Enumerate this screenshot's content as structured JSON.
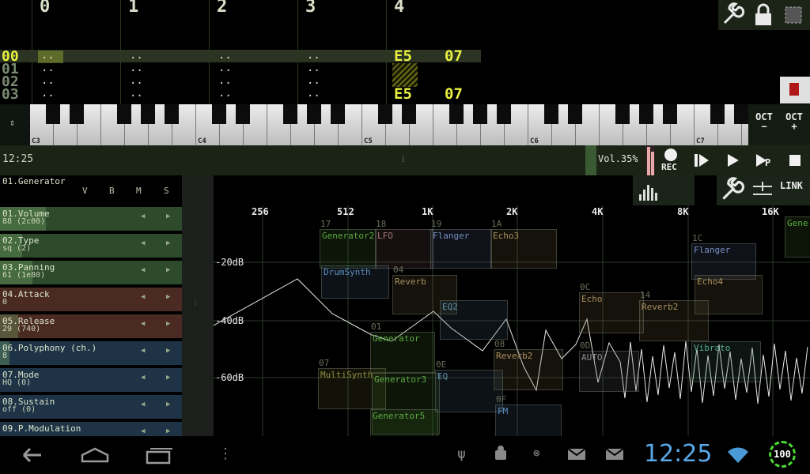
{
  "tracker": {
    "columns": [
      "0",
      "1",
      "2",
      "3",
      "4"
    ],
    "rows": [
      "00",
      "01",
      "02",
      "03"
    ],
    "empty_cell": "..",
    "notes": [
      {
        "row": "00",
        "note": "E5",
        "vol": "07"
      },
      {
        "row": "03",
        "note": "E5",
        "vol": "07"
      }
    ]
  },
  "top_icons": [
    "wrench-icon",
    "lock-icon",
    "select-icon"
  ],
  "side_button_icon": "record-pattern-icon",
  "keyboard": {
    "octave_labels": [
      "C3",
      "C4",
      "C5",
      "C6",
      "C7"
    ],
    "oct_down": "OCT-",
    "oct_down_a": "OCT",
    "oct_down_b": "−",
    "oct_up_a": "OCT",
    "oct_up_b": "+"
  },
  "transport": {
    "time": "12:25",
    "divider": "⁞",
    "volume": "Vol.35%",
    "rec": "REC",
    "p": "P"
  },
  "generator": {
    "title": "01.Generator",
    "cols": [
      "V",
      "B",
      "M",
      "S"
    ],
    "params": [
      {
        "name": "01.Volume",
        "value": "88 (2c00)",
        "color": "#2d4a2a",
        "fill": 0.25
      },
      {
        "name": "02.Type",
        "value": "sq (2)",
        "color": "#2d4a2a",
        "fill": 0.12
      },
      {
        "name": "03.Panning",
        "value": "61 (1e80)",
        "color": "#2d4a2a",
        "fill": 0.18
      },
      {
        "name": "04.Attack",
        "value": "0",
        "color": "#4a2a22",
        "fill": 0
      },
      {
        "name": "05.Release",
        "value": "29 (740)",
        "color": "#4a2a22",
        "fill": 0.1
      },
      {
        "name": "06.Polyphony (ch.)",
        "value": "8",
        "color": "#1e3446",
        "fill": 0.05
      },
      {
        "name": "07.Mode",
        "value": "HQ (0)",
        "color": "#1e3446",
        "fill": 0
      },
      {
        "name": "08.Sustain",
        "value": "off (0)",
        "color": "#1e3446",
        "fill": 0
      },
      {
        "name": "09.P.Modulation",
        "value": "",
        "color": "#1e3446",
        "fill": 0
      }
    ]
  },
  "spectrum": {
    "freq_labels": [
      "256",
      "512",
      "1K",
      "2K",
      "4K",
      "8K",
      "16K"
    ],
    "db_labels": [
      "-20dB",
      "-40dB",
      "-60dB"
    ],
    "link": "LINK",
    "modules": [
      {
        "num": "17",
        "label": "Generator2",
        "color": "#3a6a2a"
      },
      {
        "num": "18",
        "label": "LFO",
        "color": "#6a4a4a"
      },
      {
        "num": "19",
        "label": "Flanger",
        "color": "#4a5a7a"
      },
      {
        "num": "1A",
        "label": "Echo3",
        "color": "#6a5a3a"
      },
      {
        "num": "1C",
        "label": "Flanger",
        "color": "#4a5a7a"
      },
      {
        "num": "04",
        "label": "Reverb",
        "color": "#6a5a3a"
      },
      {
        "num": "",
        "label": "DrumSynth",
        "color": "#3a5a7a"
      },
      {
        "num": "",
        "label": "EQ2",
        "color": "#3a5a6a"
      },
      {
        "num": "",
        "label": "Echo4",
        "color": "#6a5a3a"
      },
      {
        "num": "0C",
        "label": "Echo",
        "color": "#6a5a3a"
      },
      {
        "num": "14",
        "label": "Reverb2",
        "color": "#6a5a3a"
      },
      {
        "num": "01",
        "label": "Generator",
        "color": "#3a6a2a"
      },
      {
        "num": "",
        "label": "Vibrato",
        "color": "#3a6a5a"
      },
      {
        "num": "08",
        "label": "Reverb2",
        "color": "#6a5a3a"
      },
      {
        "num": "0D",
        "label": "AUTO",
        "color": "#5a5a5a"
      },
      {
        "num": "07",
        "label": "MultiSynth",
        "color": "#5a5a2a"
      },
      {
        "num": "",
        "label": "Generator3",
        "color": "#3a6a2a"
      },
      {
        "num": "0E",
        "label": "EQ",
        "color": "#3a5a6a"
      },
      {
        "num": "0F",
        "label": "FM",
        "color": "#3a5a7a"
      },
      {
        "num": "",
        "label": "Generator5",
        "color": "#3a6a2a"
      },
      {
        "num": "",
        "label": "Gene",
        "color": "#3a6a2a"
      }
    ]
  },
  "statusbar": {
    "clock": "12:25",
    "battery": "100",
    "nav_icons": [
      "back-icon",
      "home-icon",
      "recent-apps-icon",
      "menu-icon"
    ],
    "notif_icons": [
      "usb-icon",
      "android-debug-icon",
      "circle-icon",
      "mail-icon",
      "mail-icon"
    ]
  }
}
